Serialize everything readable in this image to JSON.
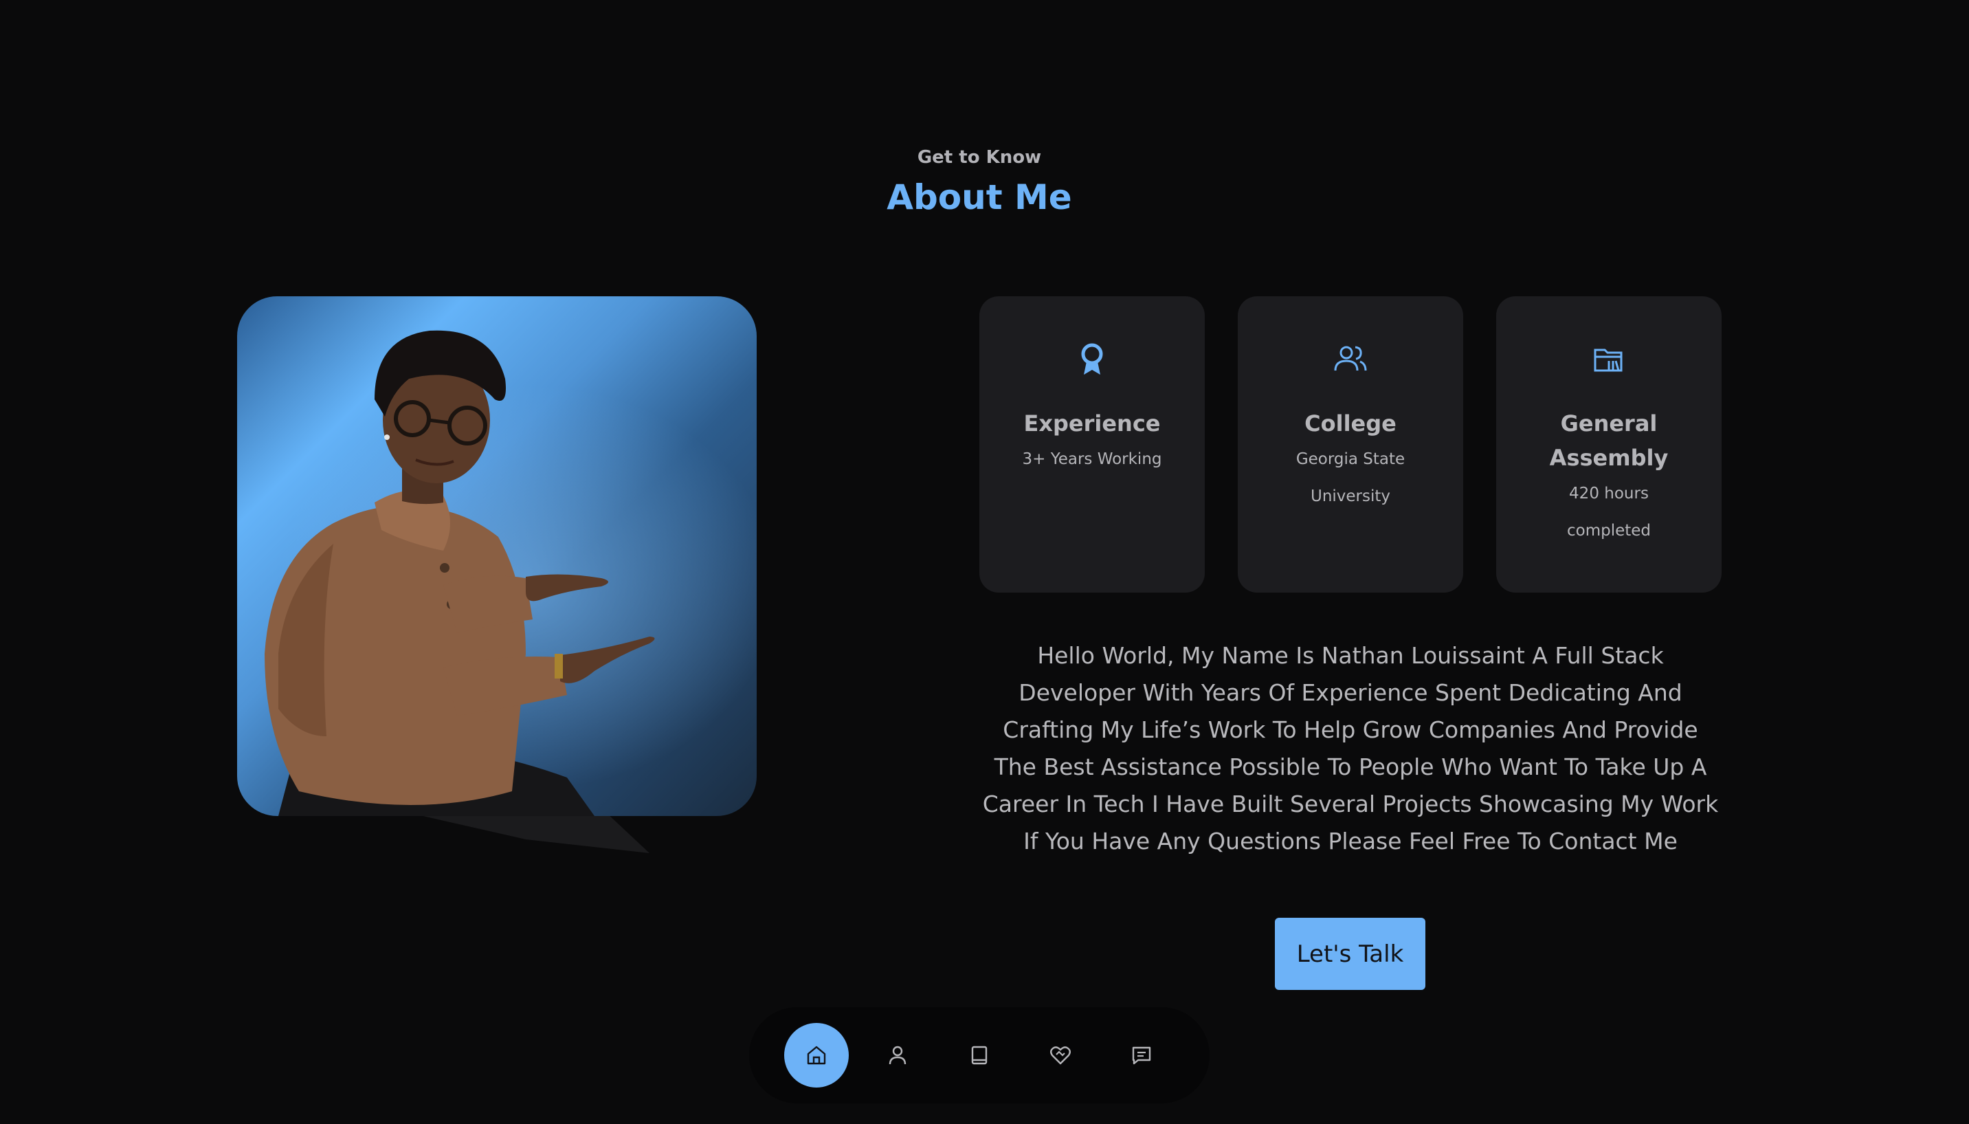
{
  "header": {
    "eyebrow": "Get to Know",
    "title": "About Me"
  },
  "cards": [
    {
      "icon": "award-icon",
      "title": "Experience",
      "lines": [
        "3+ Years Working"
      ]
    },
    {
      "icon": "users-icon",
      "title": "College",
      "lines": [
        "Georgia State",
        "University"
      ]
    },
    {
      "icon": "folder-icon",
      "title_lines": [
        "General",
        "Assembly"
      ],
      "lines": [
        "420 hours",
        "completed"
      ]
    }
  ],
  "bio": "Hello World, My Name Is Nathan Louissaint A Full Stack Developer With Years Of Experience Spent Dedicating And Crafting My Life’s Work To Help Grow Companies And Provide The Best Assistance Possible To People Who Want To Take Up A Career In Tech I Have Built Several Projects Showcasing My Work If You Have Any Questions Please Feel Free To Contact Me",
  "cta": {
    "label": "Let's Talk"
  },
  "nav": [
    {
      "icon": "home-icon",
      "active": true
    },
    {
      "icon": "user-icon",
      "active": false
    },
    {
      "icon": "book-icon",
      "active": false
    },
    {
      "icon": "heart-handshake-icon",
      "active": false
    },
    {
      "icon": "message-icon",
      "active": false
    }
  ],
  "colors": {
    "accent": "#6db2f7",
    "background": "#0a0a0b",
    "card": "#1c1c1f",
    "text": "#b6b6ba"
  }
}
